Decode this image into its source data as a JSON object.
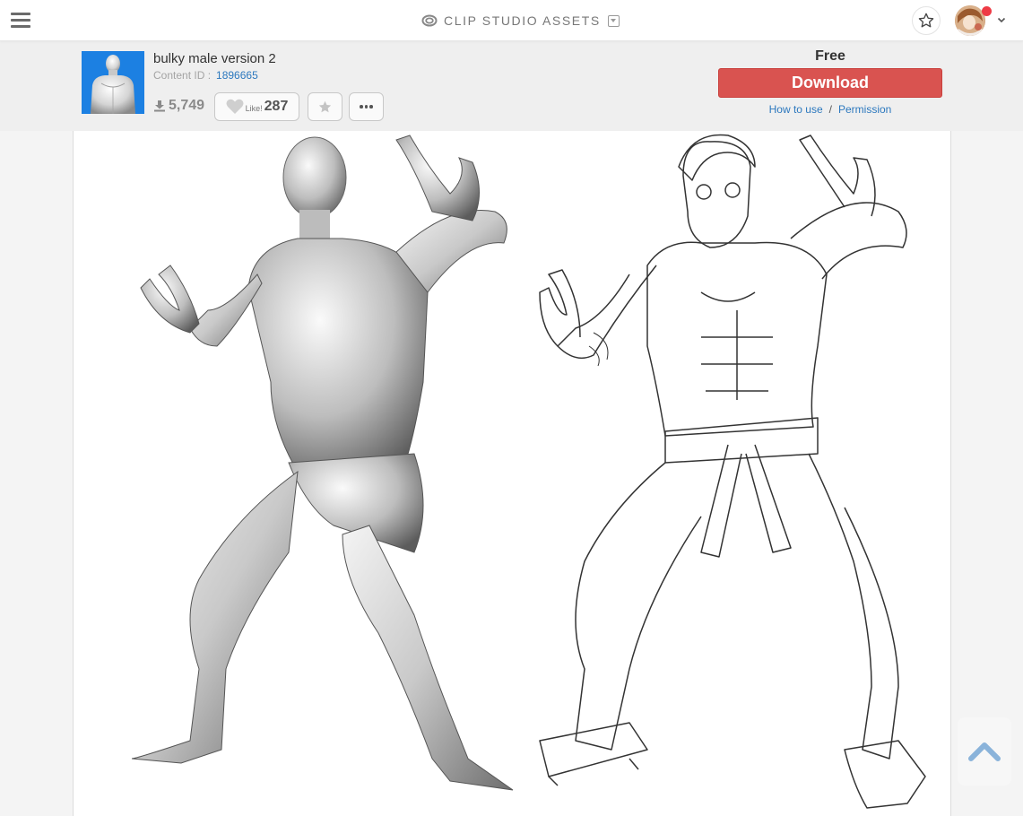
{
  "topbar": {
    "menu_icon": "hamburger-icon",
    "brand": "CLIP STUDIO ASSETS",
    "brand_icon": "clip-studio-logo-icon",
    "brand_dropdown_icon": "dropdown-square-icon",
    "favorites_icon": "star-outline-icon",
    "account_caret_icon": "chevron-down-icon",
    "notification": true
  },
  "item": {
    "title": "bulky male version 2",
    "content_id_label": "Content ID :",
    "content_id": "1896665",
    "download_count": "5,749",
    "like_label": "Like!",
    "like_count": "287",
    "favorite_icon": "star-icon",
    "more_icon": "ellipsis-icon"
  },
  "purchase": {
    "price": "Free",
    "download_label": "Download",
    "how_to_use": "How to use",
    "separator": "/",
    "permission": "Permission",
    "accent": "#d95350",
    "link_color": "#2c78be"
  },
  "content_image": {
    "description": "3D bulky male model in fighting stance beside a line-art drawing of a karate fighter in the same pose"
  },
  "back_to_top_icon": "chevron-up-icon"
}
